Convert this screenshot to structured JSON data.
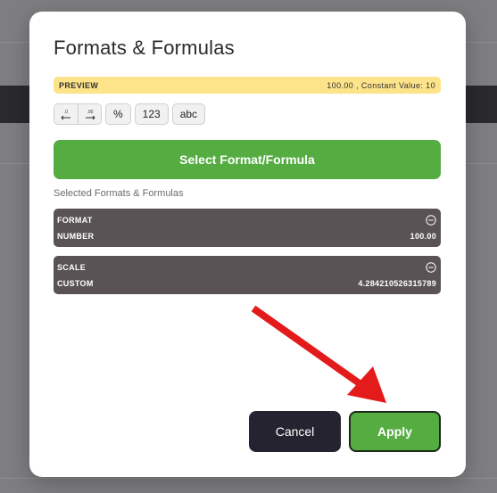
{
  "modal": {
    "title": "Formats & Formulas",
    "preview": {
      "label": "PREVIEW",
      "value": "100.00 , Constant Value: 10"
    },
    "toolbar": {
      "decrease_decimals_icon": "decrease-decimals-icon",
      "increase_decimals_icon": "increase-decimals-icon",
      "percent_label": "%",
      "number_label": "123",
      "text_label": "abc"
    },
    "select_button_label": "Select Format/Formula",
    "selected_label": "Selected Formats & Formulas",
    "items": [
      {
        "title": "FORMAT",
        "name": "NUMBER",
        "value": "100.00"
      },
      {
        "title": "SCALE",
        "name": "CUSTOM",
        "value": "4.284210526315789"
      }
    ],
    "cancel_label": "Cancel",
    "apply_label": "Apply"
  },
  "colors": {
    "accent_green": "#55ad42",
    "preview_yellow": "#fde38a",
    "card_bg": "#595356",
    "cancel_bg": "#24232f",
    "annotation_arrow": "#e31b1b"
  }
}
